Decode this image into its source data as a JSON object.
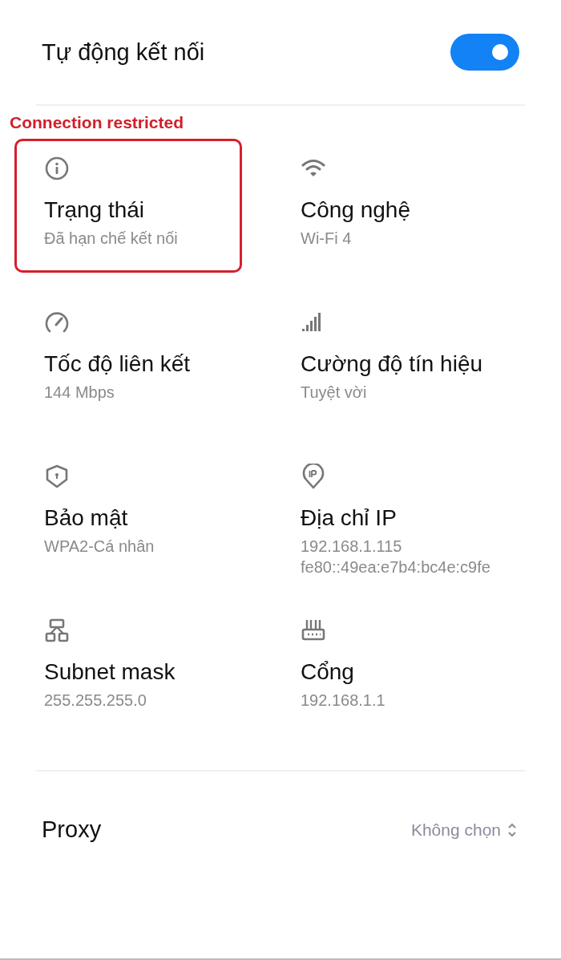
{
  "auto_connect": {
    "label": "Tự động kết nối",
    "on": true
  },
  "annotation": {
    "label": "Connection restricted"
  },
  "details": [
    {
      "title": "Trạng thái",
      "values": [
        "Đã hạn chế kết nối"
      ],
      "highlighted": true
    },
    {
      "title": "Công nghệ",
      "values": [
        "Wi-Fi 4"
      ],
      "highlighted": false
    },
    {
      "title": "Tốc độ liên kết",
      "values": [
        "144 Mbps"
      ],
      "highlighted": false
    },
    {
      "title": "Cường độ tín hiệu",
      "values": [
        "Tuyệt vời"
      ],
      "highlighted": false
    },
    {
      "title": "Bảo mật",
      "values": [
        "WPA2-Cá nhân"
      ],
      "highlighted": false
    },
    {
      "title": "Địa chỉ IP",
      "values": [
        "192.168.1.115",
        "fe80::49ea:e7b4:bc4e:c9fe"
      ],
      "highlighted": false
    },
    {
      "title": "Subnet mask",
      "values": [
        "255.255.255.0"
      ],
      "highlighted": false
    },
    {
      "title": "Cổng",
      "values": [
        "192.168.1.1"
      ],
      "highlighted": false
    }
  ],
  "proxy": {
    "label": "Proxy",
    "value": "Không chọn"
  }
}
